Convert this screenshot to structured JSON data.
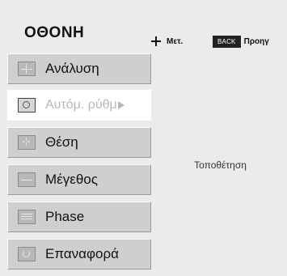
{
  "header": {
    "title": "ΟΘΟΝΗ",
    "move_icon": "four-way-arrow-icon",
    "move_label": "Μετ.",
    "back_key": "BACK",
    "back_label": "Προηγ"
  },
  "menu": {
    "items": [
      {
        "label": "Ανάλυση",
        "icon": "resolution-icon",
        "active": false
      },
      {
        "label": "Αυτόμ. ρύθμ",
        "icon": "auto-adjust-icon",
        "active": true
      },
      {
        "label": "Θέση",
        "icon": "position-icon",
        "active": false
      },
      {
        "label": "Μέγεθος",
        "icon": "size-icon",
        "active": false
      },
      {
        "label": "Phase",
        "icon": "phase-icon",
        "active": false
      },
      {
        "label": "Επαναφορά",
        "icon": "reset-icon",
        "active": false
      }
    ]
  },
  "description": "Τοποθέτηση",
  "colors": {
    "panel": "#ebebeb",
    "item": "#cfcfcf",
    "active_item": "#ffffff",
    "active_text": "#b8b8b8"
  }
}
